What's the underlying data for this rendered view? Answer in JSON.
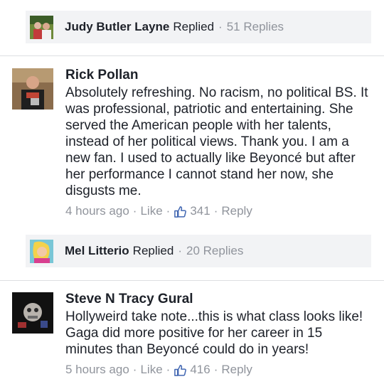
{
  "reply_bars": [
    {
      "name": "Judy Butler Layne",
      "action": "Replied",
      "count": "51 Replies"
    },
    {
      "name": "Mel Litterio",
      "action": "Replied",
      "count": "20 Replies"
    }
  ],
  "comments": [
    {
      "author": "Rick Pollan",
      "text": "Absolutely refreshing. No racism, no political BS. It was professional, patriotic and entertaining. She served the American people with her talents, instead of her political views. Thank you. I am a new fan. I used to actually like Beyoncé but after her performance I cannot stand her now, she disgusts me.",
      "time": "4 hours ago",
      "like_label": "Like",
      "likes": "341",
      "reply_label": "Reply"
    },
    {
      "author": "Steve N Tracy Gural",
      "text": "Hollyweird take note...this is what class looks like!  Gaga did more positive for her career in 15 minutes than Beyoncé could do in years!",
      "time": "5 hours ago",
      "like_label": "Like",
      "likes": "416",
      "reply_label": "Reply"
    }
  ],
  "colors": {
    "meta_gray": "#90949c",
    "reply_bg": "#f2f3f5",
    "like_blue": "#4267b2",
    "text": "#1d2129"
  },
  "icons": {
    "separator": "·",
    "like": "thumbs-up-icon"
  }
}
